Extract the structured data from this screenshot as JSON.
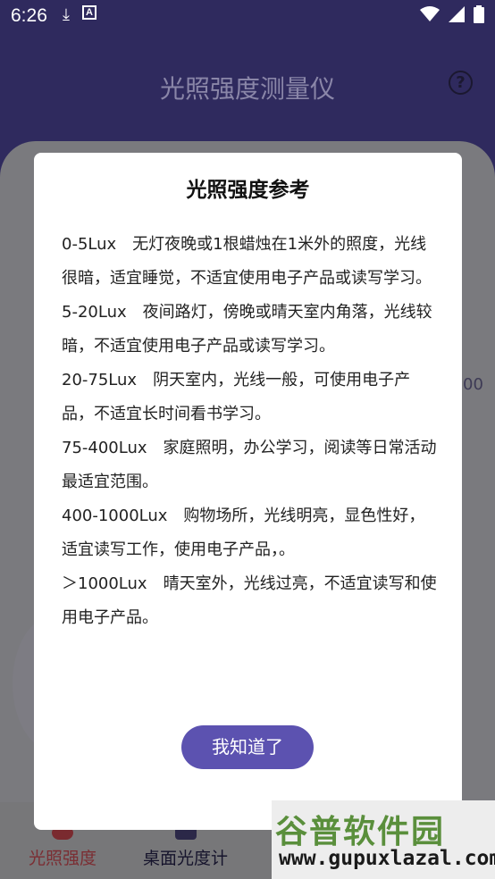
{
  "status_bar": {
    "time": "6:26",
    "left_icons": [
      "download-icon",
      "a-box-icon"
    ],
    "right_icons": [
      "wifi-icon",
      "signal-icon",
      "battery-icon"
    ]
  },
  "app": {
    "title": "光照强度测量仪",
    "side_value": "00",
    "nav": [
      {
        "label": "光照强度",
        "icon": "sun-icon",
        "color": "#7b2e33"
      },
      {
        "label": "桌面光度计",
        "icon": "desk-lamp-icon",
        "color": "#16142c"
      }
    ]
  },
  "dialog": {
    "title": "光照强度参考",
    "paragraphs": [
      "0-5Lux　无灯夜晚或1根蜡烛在1米外的照度，光线很暗，适宜睡觉，不适宜使用电子产品或读写学习。",
      " 5-20Lux　夜间路灯，傍晚或晴天室内角落，光线较暗，不适宜使用电子产品或读写学习。",
      " 20-75Lux　阴天室内，光线一般，可使用电子产品，不适宜长时间看书学习。",
      " 75-400Lux　家庭照明，办公学习，阅读等日常活动最适宜范围。",
      " 400-1000Lux　购物场所，光线明亮，显色性好，适宜读写工作，使用电子产品，。",
      "＞1000Lux　晴天室外，光线过亮，不适宜读写和使用电子产品。"
    ],
    "ok_label": "我知道了",
    "accent": "#5c52b0"
  },
  "watermark": {
    "title": "谷普软件园",
    "url": "www.gupuxlazal.com"
  }
}
